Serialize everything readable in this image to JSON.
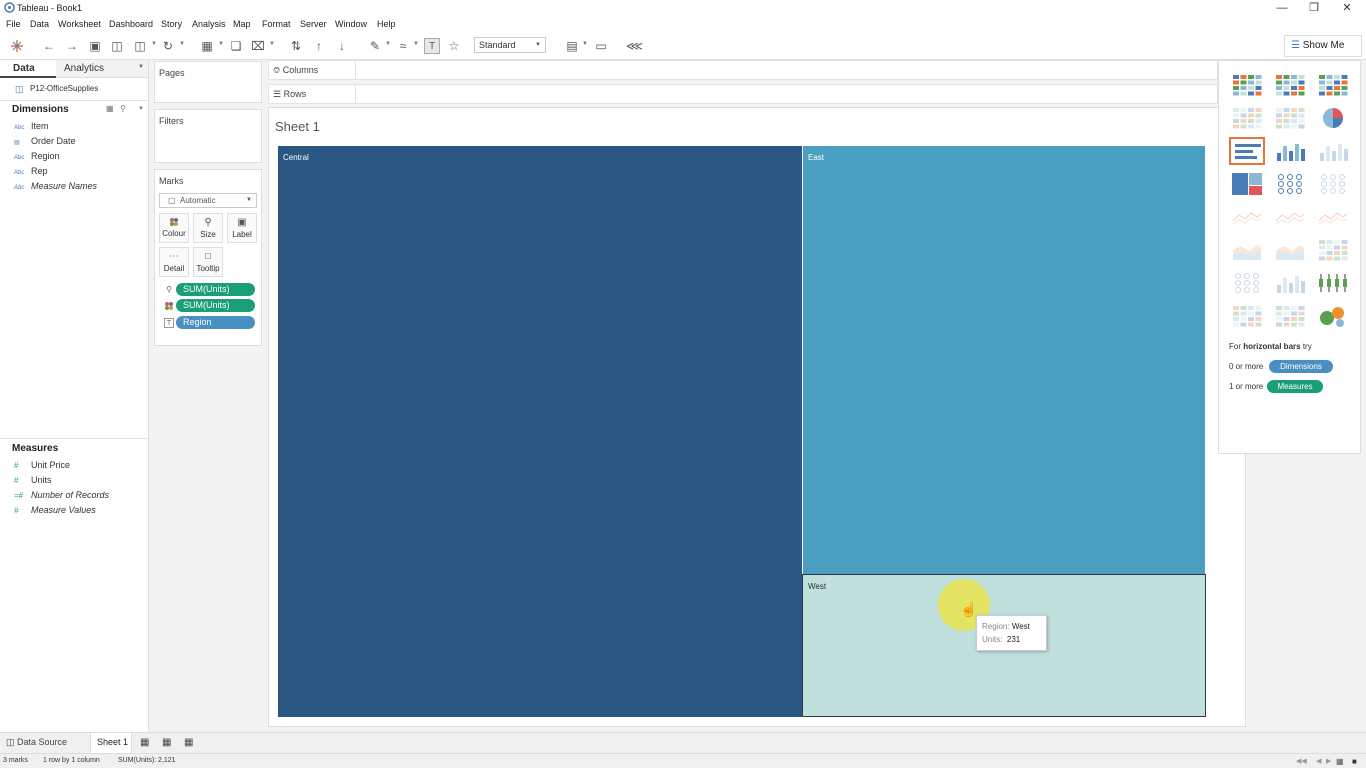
{
  "window": {
    "title": "Tableau - Book1",
    "controls": [
      "—",
      "❐",
      "✕"
    ]
  },
  "menu": [
    "File",
    "Data",
    "Worksheet",
    "Dashboard",
    "Story",
    "Analysis",
    "Map",
    "Format",
    "Server",
    "Window",
    "Help"
  ],
  "toolbar": {
    "fit_select": "Standard",
    "show_me_label": "Show Me",
    "icons": [
      "tableau-logo-icon",
      "undo-icon",
      "redo-icon",
      "save-icon",
      "new-datasource-icon",
      "pause-updates-icon",
      "refresh-icon",
      "new-worksheet-icon",
      "duplicate-sheet-icon",
      "clear-sheet-icon",
      "swap-icon",
      "sort-ascending-icon",
      "sort-descending-icon",
      "highlight-icon",
      "group-icon",
      "show-labels-icon",
      "fix-axes-icon",
      "fit-icon",
      "presentation-icon",
      "share-icon"
    ]
  },
  "data_pane": {
    "tabs": [
      "Data",
      "Analytics"
    ],
    "datasource": "P12-OfficeSupplies",
    "dimensions_header": "Dimensions",
    "dimensions": [
      {
        "type": "Abc",
        "name": "Item"
      },
      {
        "type": "cal",
        "name": "Order Date"
      },
      {
        "type": "Abc",
        "name": "Region"
      },
      {
        "type": "Abc",
        "name": "Rep"
      },
      {
        "type": "Abc",
        "name": "Measure Names"
      }
    ],
    "measures_header": "Measures",
    "measures": [
      {
        "type": "#",
        "name": "Unit Price"
      },
      {
        "type": "#",
        "name": "Units"
      },
      {
        "type": "=#",
        "name": "Number of Records"
      },
      {
        "type": "#",
        "name": "Measure Values"
      }
    ]
  },
  "shelves": {
    "pages": "Pages",
    "filters": "Filters",
    "marks": "Marks",
    "columns": "Columns",
    "rows": "Rows",
    "mark_type": "Automatic",
    "mark_buttons": [
      {
        "label": "Colour",
        "icon": "colour-icon"
      },
      {
        "label": "Size",
        "icon": "size-icon"
      },
      {
        "label": "Label",
        "icon": "label-icon"
      },
      {
        "label": "Detail",
        "icon": "detail-icon"
      },
      {
        "label": "Tooltip",
        "icon": "tooltip-icon"
      }
    ],
    "pills": [
      {
        "label": "SUM(Units)",
        "encoding": "size",
        "color": "#1a9e77"
      },
      {
        "label": "SUM(Units)",
        "encoding": "colour",
        "color": "#1a9e77"
      },
      {
        "label": "Region",
        "encoding": "label",
        "color": "#4a8fc1"
      }
    ]
  },
  "sheet": {
    "title": "Sheet 1"
  },
  "chart_data": {
    "type": "treemap",
    "categories": [
      "Central",
      "East",
      "West"
    ],
    "colors": [
      "#2a5783",
      "#4a9ec2",
      "#bfe0dc"
    ]
  },
  "tooltip": {
    "region_key": "Region:",
    "region_value": "West",
    "units_key": "Units:",
    "units_value": "231"
  },
  "show_me": {
    "hint_prefix": "For",
    "hint_bold": "horizontal bars",
    "hint_suffix": "try",
    "dim_prefix": "0 or more",
    "dim_pill": "Dimensions",
    "meas_prefix": "1 or more",
    "meas_pill": "Measures"
  },
  "tabs": {
    "data_source": "Data Source",
    "sheet1": "Sheet 1"
  },
  "status": {
    "marks": "3 marks",
    "layout": "1 row by 1 column",
    "sum": "SUM(Units): 2,121"
  }
}
